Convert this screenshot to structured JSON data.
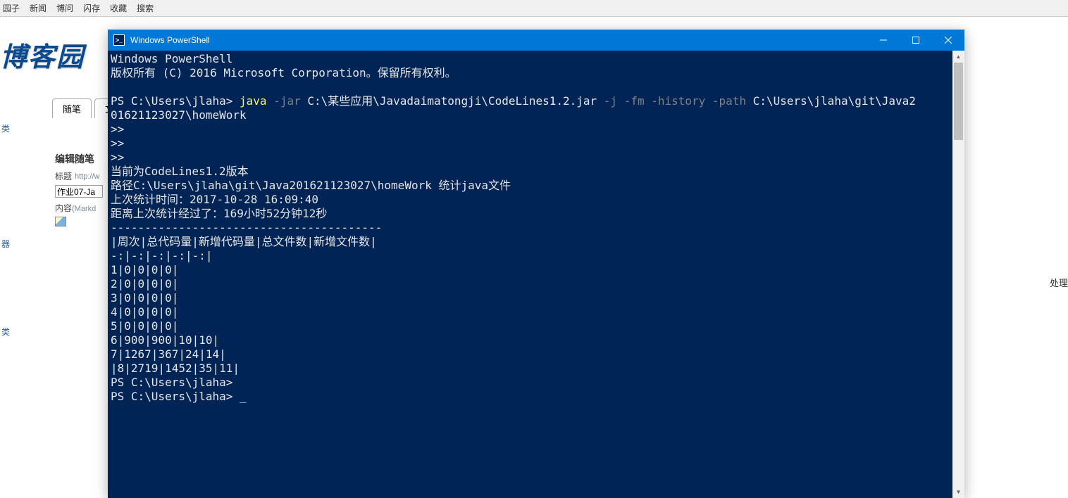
{
  "browser_menu": {
    "items": [
      "园子",
      "新闻",
      "博问",
      "闪存",
      "收藏",
      "搜索"
    ]
  },
  "blog": {
    "logo": "博客园"
  },
  "tabs": {
    "t1": "随笔",
    "t2": "文"
  },
  "editor": {
    "header": "编辑随笔",
    "title_label": "标题",
    "title_hint": "http://w",
    "title_value": "作业07-Ja",
    "content_label": "内容",
    "content_hint": "(Markd"
  },
  "left_cat": {
    "c1": "类",
    "c2": "器",
    "c3": "类"
  },
  "right_text": "处理",
  "powershell": {
    "title": "Windows PowerShell",
    "header_line1": "Windows PowerShell",
    "header_line2": "版权所有 (C) 2016 Microsoft Corporation。保留所有权利。",
    "prompt1_pre": "PS C:\\Users\\jlaha> ",
    "cmd_java": "java",
    "cmd_jar": " -jar ",
    "cmd_jarpath": "C:\\某些应用\\Javadaimatongji\\CodeLines1.2.jar",
    "cmd_flags": " -j -fm -history -path ",
    "cmd_path_tail": "C:\\Users\\jlaha\\git\\Java2",
    "cmd_wrap": "01621123027\\homeWork",
    "gt1": ">>",
    "gt2": ">>",
    "gt3": ">>",
    "ver_line": "当前为CodeLines1.2版本",
    "path_line": "路径C:\\Users\\jlaha\\git\\Java201621123027\\homeWork 统计java文件",
    "last_time": "上次统计时间：2017-10-28 16:09:40",
    "elapsed": "距离上次统计经过了：169小时52分钟12秒",
    "dashes": "----------------------------------------",
    "table_header": "|周次|总代码量|新增代码量|总文件数|新增文件数|",
    "table_sep": "-:|-:|-:|-:|-:|",
    "row1": "1|0|0|0|0|",
    "row2": "2|0|0|0|0|",
    "row3": "3|0|0|0|0|",
    "row4": "4|0|0|0|0|",
    "row5": "5|0|0|0|0|",
    "row6": "6|900|900|10|10|",
    "row7": "7|1267|367|24|14|",
    "row8": "|8|2719|1452|35|11|",
    "prompt2": "PS C:\\Users\\jlaha>",
    "prompt3": "PS C:\\Users\\jlaha> ",
    "cursor": "_"
  }
}
